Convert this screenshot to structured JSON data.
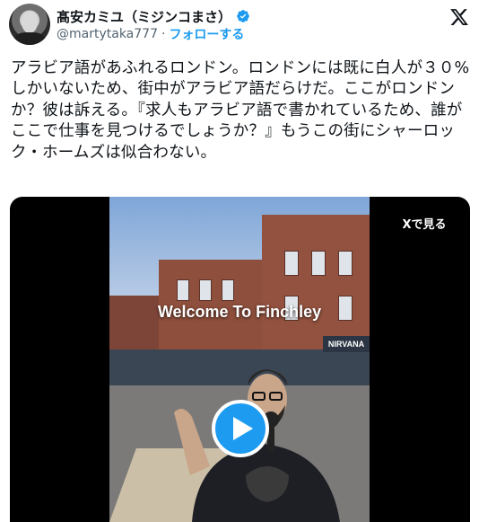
{
  "author": {
    "display_name": "髙安カミユ（ミジンコまさ）",
    "handle": "@martytaka777",
    "separator": "·",
    "follow_label": "フォローする",
    "verified": true
  },
  "icons": {
    "verified": "verified-badge-icon",
    "x_logo": "x-logo-icon",
    "play": "play-icon"
  },
  "tweet": {
    "text": "アラビア語があふれるロンドン。ロンドンには既に白人が３０%しかいないため、街中がアラビア語だらけだ。ここがロンドンか？彼は訴える。『求人もアラビア語で書かれているため、誰がここで仕事を見つけるでしょうか？』もうこの街にシャーロック・ホームズは似合わない。"
  },
  "media": {
    "overlay_caption": "Welcome To Finchley",
    "view_on_x_label": "Xで見る",
    "shop_sign": "NIRVANA"
  },
  "colors": {
    "accent": "#1d9bf0",
    "text_primary": "#0f1419",
    "text_secondary": "#536471",
    "background": "#ffffff"
  }
}
